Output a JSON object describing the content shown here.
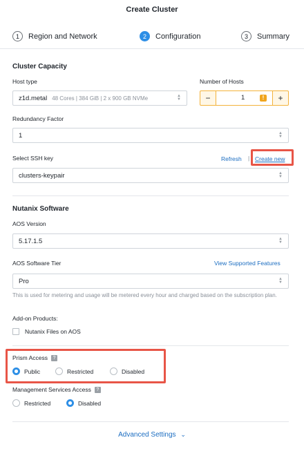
{
  "header": {
    "title": "Create Cluster"
  },
  "steps": [
    {
      "num": "1",
      "label": "Region and Network"
    },
    {
      "num": "2",
      "label": "Configuration"
    },
    {
      "num": "3",
      "label": "Summary"
    }
  ],
  "cluster_capacity": {
    "title": "Cluster Capacity",
    "host_type": {
      "label": "Host type",
      "value": "z1d.metal",
      "detail": "48 Cores | 384 GiB | 2 x 900 GB NVMe"
    },
    "num_hosts": {
      "label": "Number of Hosts",
      "value": "1",
      "minus": "−",
      "plus": "+",
      "warning": "!"
    },
    "redundancy": {
      "label": "Redundancy Factor",
      "value": "1"
    },
    "ssh": {
      "label": "Select SSH key",
      "refresh": "Refresh",
      "separator": "|",
      "create_new": "Create new",
      "value": "clusters-keypair"
    }
  },
  "nutanix_software": {
    "title": "Nutanix Software",
    "aos_version": {
      "label": "AOS Version",
      "value": "5.17.1.5"
    },
    "aos_tier": {
      "label": "AOS Software Tier",
      "link": "View Supported Features",
      "value": "Pro",
      "help": "This is used for metering and usage will be metered every hour and charged based on the subscription plan."
    },
    "addons": {
      "label": "Add-on Products:",
      "item": "Nutanix Files on AOS"
    }
  },
  "prism_access": {
    "label": "Prism Access",
    "help": "?",
    "options": [
      "Public",
      "Restricted",
      "Disabled"
    ],
    "selected": "Public"
  },
  "mgmt_access": {
    "label": "Management Services Access",
    "help": "?",
    "options": [
      "Restricted",
      "Disabled"
    ],
    "selected": "Disabled"
  },
  "advanced": {
    "label": "Advanced Settings",
    "chevron": "⌄"
  },
  "colors": {
    "accent": "#2e8fe6",
    "link": "#1b6dc1",
    "highlight": "#e85547",
    "warning": "#f0a51e"
  }
}
